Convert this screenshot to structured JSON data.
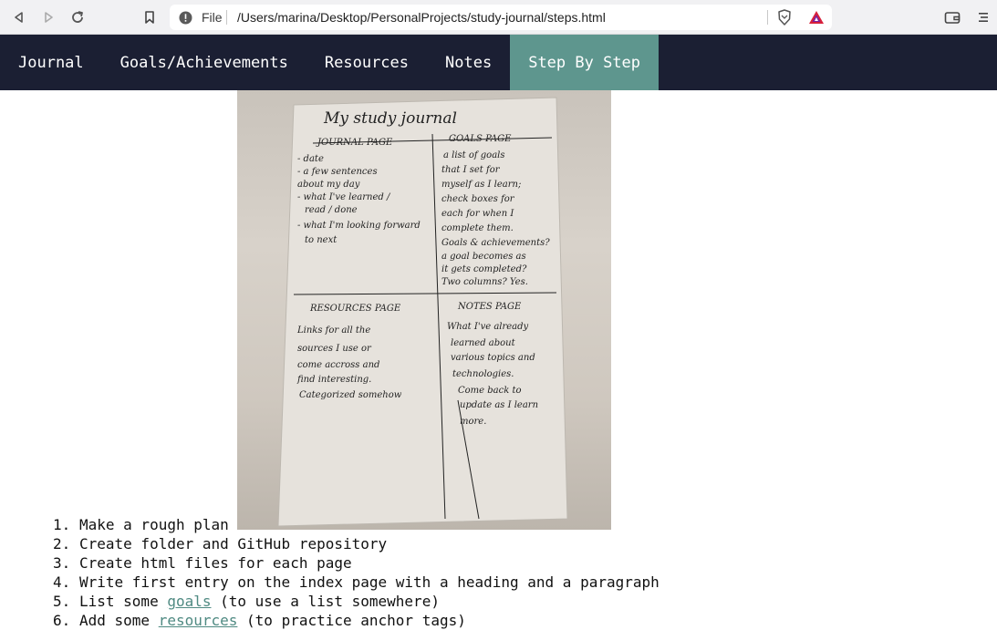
{
  "browser": {
    "scheme_label": "File",
    "url": "/Users/marina/Desktop/PersonalProjects/study-journal/steps.html"
  },
  "nav": {
    "items": [
      {
        "label": "Journal"
      },
      {
        "label": "Goals/Achievements"
      },
      {
        "label": "Resources"
      },
      {
        "label": "Notes"
      },
      {
        "label": "Step By Step"
      }
    ],
    "active_index": 4
  },
  "photo": {
    "alt": "Handwritten study journal plan",
    "title": "My study journal",
    "sections": [
      {
        "heading": "JOURNAL PAGE",
        "lines": [
          "- date",
          "- a few sentences",
          "about my day",
          "- what I've learned /",
          "read / done",
          "- what I'm looking forward",
          "to next"
        ]
      },
      {
        "heading": "GOALS PAGE",
        "lines": [
          "a list of goals",
          "that I set for",
          "myself as I learn;",
          "check boxes for",
          "each for when I",
          "complete them.",
          "Goals & achievements?",
          "a goal becomes as",
          "it gets completed?",
          "Two columns? Yes."
        ]
      },
      {
        "heading": "RESOURCES PAGE",
        "lines": [
          "Links for all the",
          "sources I use or",
          "come accross and",
          "find interesting.",
          "Categorized somehow"
        ]
      },
      {
        "heading": "NOTES PAGE",
        "lines": [
          "What I've already",
          "learned about",
          "various topics and",
          "technologies.",
          "Come back to",
          "update as I learn",
          "more."
        ]
      }
    ]
  },
  "steps": [
    {
      "num": "1.",
      "before": "Make a rough plan",
      "link": "",
      "after": ""
    },
    {
      "num": "2.",
      "before": "Create folder and GitHub repository",
      "link": "",
      "after": ""
    },
    {
      "num": "3.",
      "before": "Create html files for each page",
      "link": "",
      "after": ""
    },
    {
      "num": "4.",
      "before": "Write first entry on the index page with a heading and a paragraph",
      "link": "",
      "after": ""
    },
    {
      "num": "5.",
      "before": "List some ",
      "link": "goals",
      "after": " (to use a list somewhere)"
    },
    {
      "num": "6.",
      "before": "Add some ",
      "link": "resources",
      "after": " (to practice anchor tags)"
    }
  ],
  "colors": {
    "nav_bg": "#1b1f33",
    "nav_active": "#5e968e",
    "link": "#4f8a82"
  },
  "icons": [
    "back-icon",
    "forward-icon",
    "reload-icon",
    "bookmark-icon",
    "info-icon",
    "brave-shield-icon",
    "brave-rewards-icon",
    "wallet-icon",
    "menu-icon"
  ]
}
